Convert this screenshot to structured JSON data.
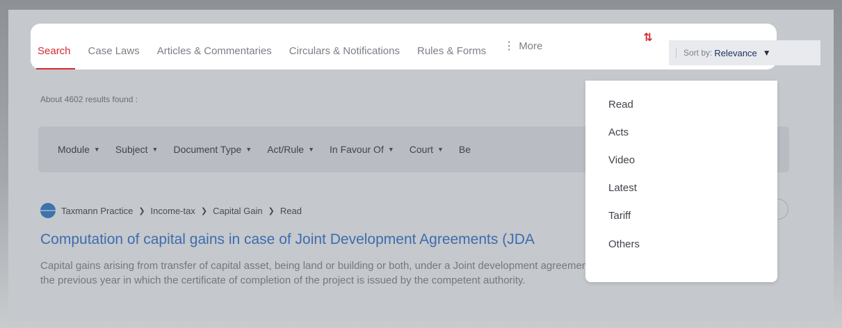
{
  "tabs": [
    {
      "label": "Search"
    },
    {
      "label": "Case Laws"
    },
    {
      "label": "Articles & Commentaries"
    },
    {
      "label": "Circulars & Notifications"
    },
    {
      "label": "Rules & Forms"
    }
  ],
  "more_label": "More",
  "sort": {
    "label": "Sort by:",
    "value": "Relevance"
  },
  "results_text": "About 4602 results found :",
  "filters": [
    {
      "label": "Module"
    },
    {
      "label": "Subject"
    },
    {
      "label": "Document Type"
    },
    {
      "label": "Act/Rule"
    },
    {
      "label": "In Favour Of"
    },
    {
      "label": "Court"
    },
    {
      "label": "Be"
    }
  ],
  "breadcrumb": [
    "Taxmann Practice",
    "Income-tax",
    "Capital Gain",
    "Read"
  ],
  "result": {
    "title": "Computation of capital gains in case of Joint Development Agreements (JDA",
    "description": "Capital gains arising from transfer of capital asset, being land or building or both, under a Joint development agreement shall be chargeable to tax as income of the previous year in which the certificate of completion of the project is issued by the competent authority."
  },
  "dropdown": [
    "Read",
    "Acts",
    "Video",
    "Latest",
    "Tariff",
    "Others"
  ],
  "colors": {
    "accent": "#d32a2f",
    "link": "#2b6fcf",
    "sort_value": "#1c2f5c"
  },
  "icons": [
    "vertical-dots-icon",
    "sort-icon",
    "chevron-down-icon",
    "globe-icon",
    "file-icon"
  ]
}
